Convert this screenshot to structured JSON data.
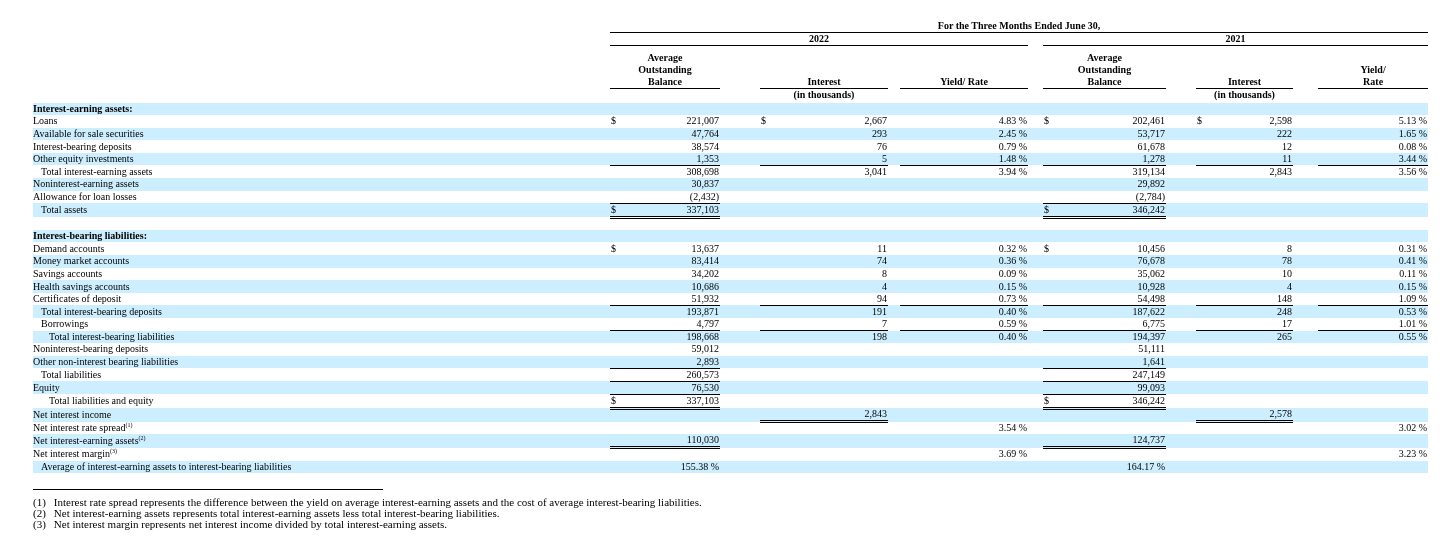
{
  "period_title": "For the Three Months Ended June 30,",
  "years": [
    {
      "label": "2022",
      "columns": [
        {
          "heading": [
            "Average",
            "Outstanding",
            "Balance"
          ]
        },
        {
          "heading": [
            "Interest"
          ],
          "note": "(in thousands)"
        },
        {
          "heading": [
            "Yield/ Rate"
          ]
        }
      ]
    },
    {
      "label": "2021",
      "columns": [
        {
          "heading": [
            "Average",
            "Outstanding",
            "Balance"
          ]
        },
        {
          "heading": [
            "Interest"
          ],
          "note": "(in thousands)"
        },
        {
          "heading": [
            "Yield/",
            "Rate"
          ]
        }
      ]
    }
  ],
  "rows": [
    {
      "kind": "heading",
      "label": "Interest-earning assets:"
    },
    {
      "kind": "item",
      "label": "Loans",
      "cells": [
        {
          "sign": "$",
          "value": "221,007"
        },
        {
          "sign": "$",
          "value": "2,667"
        },
        {
          "value": "4.83 %"
        },
        {
          "sign": "$",
          "value": "202,461"
        },
        {
          "sign": "$",
          "value": "2,598"
        },
        {
          "value": "5.13 %"
        }
      ]
    },
    {
      "kind": "item",
      "label": "Available for sale securities",
      "cells": [
        {
          "value": "47,764"
        },
        {
          "value": "293"
        },
        {
          "value": "2.45 %"
        },
        {
          "value": "53,717"
        },
        {
          "value": "222"
        },
        {
          "value": "1.65 %"
        }
      ]
    },
    {
      "kind": "item",
      "label": "Interest-bearing deposits",
      "cells": [
        {
          "value": "38,574"
        },
        {
          "value": "76"
        },
        {
          "value": "0.79 %"
        },
        {
          "value": "61,678"
        },
        {
          "value": "12"
        },
        {
          "value": "0.08 %"
        }
      ]
    },
    {
      "kind": "item",
      "label": "Other equity investments",
      "underlined": true,
      "cells": [
        {
          "value": "1,353"
        },
        {
          "value": "5"
        },
        {
          "value": "1.48 %"
        },
        {
          "value": "1,278"
        },
        {
          "value": "11"
        },
        {
          "value": "3.44 %"
        }
      ]
    },
    {
      "kind": "sub",
      "label": "Total interest-earning assets",
      "cells": [
        {
          "value": "308,698"
        },
        {
          "value": "3,041"
        },
        {
          "value": "3.94 %"
        },
        {
          "value": "319,134"
        },
        {
          "value": "2,843"
        },
        {
          "value": "3.56 %"
        }
      ]
    },
    {
      "kind": "item",
      "label": "Noninterest-earning assets",
      "cells": [
        {
          "value": "30,837"
        },
        null,
        null,
        {
          "value": "29,892"
        },
        null,
        null
      ]
    },
    {
      "kind": "item",
      "label": "Allowance for loan losses",
      "underlined": true,
      "cells": [
        {
          "value": "(2,432)"
        },
        null,
        null,
        {
          "value": "(2,784)"
        },
        null,
        null
      ]
    },
    {
      "kind": "sub",
      "label": "Total assets",
      "double_underlined": true,
      "cells": [
        {
          "sign": "$",
          "value": "337,103"
        },
        null,
        null,
        {
          "sign": "$",
          "value": "346,242"
        },
        null,
        null
      ]
    },
    {
      "kind": "blank"
    },
    {
      "kind": "heading",
      "label": "Interest-bearing liabilities:"
    },
    {
      "kind": "item",
      "label": "Demand accounts",
      "cells": [
        {
          "sign": "$",
          "value": "13,637"
        },
        {
          "value": "11"
        },
        {
          "value": "0.32 %"
        },
        {
          "sign": "$",
          "value": "10,456"
        },
        {
          "value": "8"
        },
        {
          "value": "0.31 %"
        }
      ]
    },
    {
      "kind": "item",
      "label": "Money market accounts",
      "cells": [
        {
          "value": "83,414"
        },
        {
          "value": "74"
        },
        {
          "value": "0.36 %"
        },
        {
          "value": "76,678"
        },
        {
          "value": "78"
        },
        {
          "value": "0.41 %"
        }
      ]
    },
    {
      "kind": "item",
      "label": "Savings accounts",
      "cells": [
        {
          "value": "34,202"
        },
        {
          "value": "8"
        },
        {
          "value": "0.09 %"
        },
        {
          "value": "35,062"
        },
        {
          "value": "10"
        },
        {
          "value": "0.11 %"
        }
      ]
    },
    {
      "kind": "item",
      "label": "Health savings accounts",
      "cells": [
        {
          "value": "10,686"
        },
        {
          "value": "4"
        },
        {
          "value": "0.15 %"
        },
        {
          "value": "10,928"
        },
        {
          "value": "4"
        },
        {
          "value": "0.15 %"
        }
      ]
    },
    {
      "kind": "item",
      "label": "Certificates of deposit",
      "underlined": true,
      "cells": [
        {
          "value": "51,932"
        },
        {
          "value": "94"
        },
        {
          "value": "0.73 %"
        },
        {
          "value": "54,498"
        },
        {
          "value": "148"
        },
        {
          "value": "1.09 %"
        }
      ]
    },
    {
      "kind": "sub",
      "label": "Total interest-bearing deposits",
      "cells": [
        {
          "value": "193,871"
        },
        {
          "value": "191"
        },
        {
          "value": "0.40 %"
        },
        {
          "value": "187,622"
        },
        {
          "value": "248"
        },
        {
          "value": "0.53 %"
        }
      ]
    },
    {
      "kind": "sub",
      "label": "Borrowings",
      "underlined": true,
      "cells": [
        {
          "value": "4,797"
        },
        {
          "value": "7"
        },
        {
          "value": "0.59 %"
        },
        {
          "value": "6,775"
        },
        {
          "value": "17"
        },
        {
          "value": "1.01 %"
        }
      ]
    },
    {
      "kind": "subsub",
      "label": "Total interest-bearing liabilities",
      "cells": [
        {
          "value": "198,668"
        },
        {
          "value": "198"
        },
        {
          "value": "0.40 %"
        },
        {
          "value": "194,397"
        },
        {
          "value": "265"
        },
        {
          "value": "0.55 %"
        }
      ]
    },
    {
      "kind": "item",
      "label": "Noninterest-bearing deposits",
      "cells": [
        {
          "value": "59,012"
        },
        null,
        null,
        {
          "value": "51,111"
        },
        null,
        null
      ]
    },
    {
      "kind": "item",
      "label": "Other non-interest bearing liabilities",
      "underlined": true,
      "cells": [
        {
          "value": "2,893"
        },
        null,
        null,
        {
          "value": "1,641"
        },
        null,
        null
      ]
    },
    {
      "kind": "sub",
      "label": "Total liabilities",
      "underlined": true,
      "cells": [
        {
          "value": "260,573"
        },
        null,
        null,
        {
          "value": "247,149"
        },
        null,
        null
      ]
    },
    {
      "kind": "item",
      "label": "Equity",
      "underlined": true,
      "cells": [
        {
          "value": "76,530"
        },
        null,
        null,
        {
          "value": "99,093"
        },
        null,
        null
      ]
    },
    {
      "kind": "subsub",
      "label": "Total liabilities and equity",
      "double_underlined": true,
      "cells": [
        {
          "sign": "$",
          "value": "337,103"
        },
        null,
        null,
        {
          "sign": "$",
          "value": "346,242"
        },
        null,
        null
      ]
    },
    {
      "kind": "item",
      "label": "Net interest income",
      "double_underlined": true,
      "cells": [
        null,
        {
          "value": "2,843"
        },
        null,
        null,
        {
          "value": "2,578"
        },
        null
      ]
    },
    {
      "kind": "item",
      "label": "Net interest rate spread$^{(1)}$",
      "cells": [
        null,
        null,
        {
          "value": "3.54 %"
        },
        null,
        null,
        {
          "value": "3.02 %"
        }
      ]
    },
    {
      "kind": "item",
      "label": "Net interest-earning assets$^{(2)}$",
      "double_underlined": true,
      "cells": [
        {
          "value": "110,030"
        },
        null,
        null,
        {
          "value": "124,737"
        },
        null,
        null
      ]
    },
    {
      "kind": "item",
      "label": "Net interest margin$^{(3)}$",
      "cells": [
        null,
        null,
        {
          "value": "3.69 %"
        },
        null,
        null,
        {
          "value": "3.23 %"
        }
      ]
    },
    {
      "kind": "sub",
      "label": "Average of interest-earning assets to interest-bearing liabilities",
      "cells": [
        {
          "value": "155.38 %"
        },
        null,
        null,
        {
          "value": "164.17 %"
        },
        null,
        null
      ]
    }
  ],
  "footnotes": [
    {
      "marker": "(1)",
      "text": "Interest rate spread represents the difference between the yield on average interest-earning assets and the cost of average interest-bearing liabilities."
    },
    {
      "marker": "(2)",
      "text": "Net interest-earning assets represents total interest-earning assets less total interest-bearing liabilities."
    },
    {
      "marker": "(3)",
      "text": "Net interest margin represents net interest income divided by total interest-earning assets."
    }
  ]
}
